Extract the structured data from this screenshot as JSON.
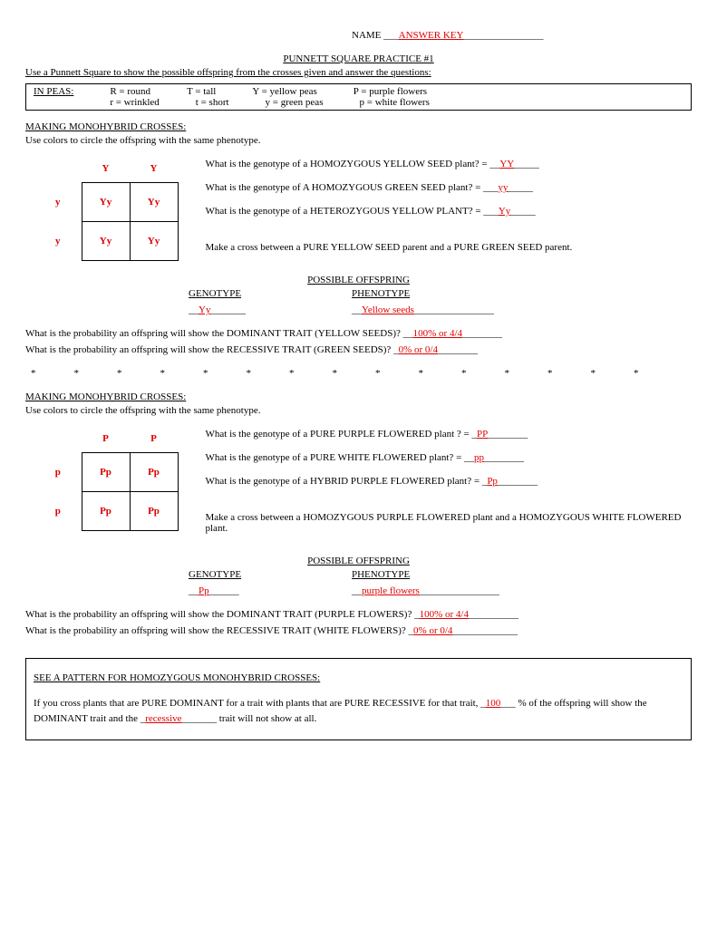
{
  "header": {
    "name_label": "NAME ___",
    "answer_key": "ANSWER KEY",
    "title": "PUNNETT SQUARE PRACTICE #1",
    "instructions": "Use a Punnett Square to show the possible offspring from the crosses given and answer the questions:"
  },
  "legend": {
    "in_peas": "IN PEAS:",
    "R": "R = round",
    "r": "r = wrinkled",
    "T": "T = tall",
    "t": "t = short",
    "Y": "Y = yellow peas",
    "y": "y = green peas",
    "P": "P = purple flowers",
    "p": "p = white flowers"
  },
  "section1": {
    "title": "MAKING MONOHYBRID CROSSES:",
    "sub": "Use colors to circle the offspring with the same phenotype.",
    "punnett": {
      "top": [
        "Y",
        "Y"
      ],
      "side": [
        "y",
        "y"
      ],
      "cells": [
        "Yy",
        "Yy",
        "Yy",
        "Yy"
      ]
    },
    "q1_pre": "What is the genotype of a  HOMOZYGOUS YELLOW SEED plant?  = __",
    "q1_ans": "YY",
    "q2_pre": "What is the genotype of A HOMOZYGOUS GREEN SEED plant? = ___",
    "q2_ans": "yy",
    "q3_pre": "What is the genotype of a HETEROZYGOUS YELLOW PLANT? = ___",
    "q3_ans": "Yy",
    "cross_instr": "Make a cross between a PURE YELLOW SEED parent and a PURE GREEN SEED parent.",
    "poss_hdr": "POSSIBLE OFFSPRING",
    "geno_hdr": "GENOTYPE",
    "pheno_hdr": "PHENOTYPE",
    "geno_ans": "Yy",
    "pheno_ans": "Yellow seeds",
    "prob1_pre": "What is the probability an offspring will show the DOMINANT TRAIT (YELLOW SEEDS)? __",
    "prob1_ans": "100% or 4/4",
    "prob2_pre": "What is the probability an offspring will show the RECESSIVE TRAIT (GREEN SEEDS)?  _",
    "prob2_ans": "0% or 0/4"
  },
  "stars": "***************",
  "section2": {
    "title": "MAKING MONOHYBRID CROSSES:",
    "sub": "Use colors to circle the offspring with the same phenotype.",
    "punnett": {
      "top": [
        "P",
        "P"
      ],
      "side": [
        "p",
        "p"
      ],
      "cells": [
        "Pp",
        "Pp",
        "Pp",
        "Pp"
      ]
    },
    "q1_pre": "What is the genotype of a PURE PURPLE FLOWERED plant ?  = _",
    "q1_ans": "PP",
    "q2_pre": "What is the genotype of a PURE WHITE FLOWERED plant?  = __",
    "q2_ans": "pp",
    "q3_pre": "What is the genotype of a HYBRID PURPLE FLOWERED plant? = _",
    "q3_ans": "Pp",
    "cross_instr": "Make a cross between a HOMOZYGOUS  PURPLE FLOWERED plant and a HOMOZYGOUS WHITE FLOWERED plant.",
    "poss_hdr": "POSSIBLE OFFSPRING",
    "geno_hdr": "GENOTYPE",
    "pheno_hdr": "PHENOTYPE",
    "geno_ans": "Pp",
    "pheno_ans": "purple flowers",
    "prob1_pre": "What is the probability an offspring will show the DOMINANT TRAIT (PURPLE FLOWERS)? _",
    "prob1_ans": "100% or 4/4",
    "prob2_pre": "What is the probability an offspring will show the RECESSIVE TRAIT (WHITE FLOWERS)?  _",
    "prob2_ans": "0% or 0/4"
  },
  "pattern": {
    "title": "SEE A PATTERN FOR HOMOZYGOUS MONOHYBRID CROSSES:",
    "text_a": "If you cross plants that are PURE DOMINANT for a trait with plants that are PURE RECESSIVE for that trait, _",
    "ans1": "100",
    "text_b": "___  %  of the offspring will show the DOMINANT trait and the _",
    "ans2": "recessive",
    "text_c": "_______ trait will not show at all."
  }
}
